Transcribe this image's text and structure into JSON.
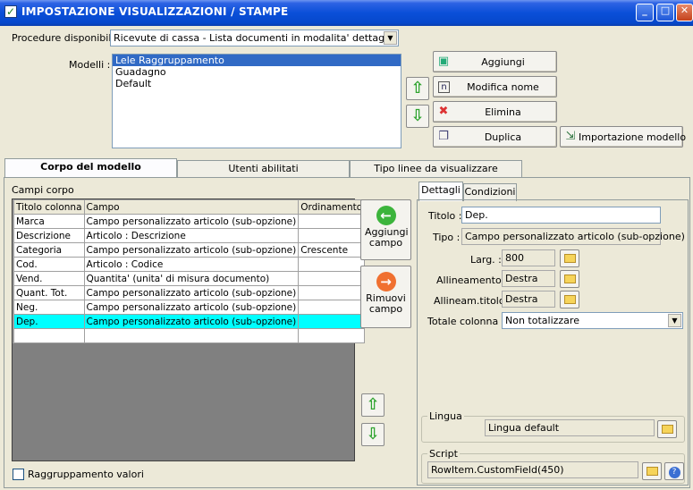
{
  "window": {
    "title": "IMPOSTAZIONE VISUALIZZAZIONI / STAMPE"
  },
  "procedure": {
    "label": "Procedure disponibili :",
    "value": "Ricevute di cassa - Lista documenti in modalita' dettaglio"
  },
  "modelli": {
    "label": "Modelli :",
    "items": [
      "Lele Raggruppamento",
      "Guadagno",
      "Default"
    ],
    "selected_index": 0
  },
  "buttons": {
    "aggiungi": "Aggiungi",
    "modifica_nome": "Modifica nome",
    "elimina": "Elimina",
    "duplica": "Duplica",
    "importazione": "Importazione modello"
  },
  "tabs": [
    "Corpo del modello",
    "Utenti abilitati",
    "Tipo linee da visualizzare"
  ],
  "campi_corpo": {
    "label": "Campi corpo",
    "columns": [
      "Titolo colonna",
      "Campo",
      "Ordinamento"
    ],
    "rows": [
      [
        "Marca",
        "Campo personalizzato articolo (sub-opzione)",
        ""
      ],
      [
        "Descrizione",
        "Articolo : Descrizione",
        ""
      ],
      [
        "Categoria",
        "Campo personalizzato articolo (sub-opzione)",
        "Crescente"
      ],
      [
        "Cod.",
        "Articolo : Codice",
        ""
      ],
      [
        "Vend.",
        "Quantita' (unita' di misura documento)",
        ""
      ],
      [
        "Quant. Tot.",
        "Campo personalizzato articolo (sub-opzione)",
        ""
      ],
      [
        "Neg.",
        "Campo personalizzato articolo (sub-opzione)",
        ""
      ],
      [
        "Dep.",
        "Campo personalizzato articolo (sub-opzione)",
        ""
      ],
      [
        "",
        "",
        ""
      ]
    ],
    "selected_row": 7
  },
  "side_buttons": {
    "aggiungi_campo": "Aggiungi campo",
    "rimuovi_campo": "Rimuovi campo"
  },
  "detail_tabs": [
    "Dettagli",
    "Condizioni"
  ],
  "dettagli": {
    "titolo_label": "Titolo :",
    "titolo": "Dep.",
    "tipo_label": "Tipo :",
    "tipo": "Campo personalizzato articolo (sub-opzione)",
    "larg_label": "Larg. :",
    "larg": "800",
    "allineamento_label": "Allineamento :",
    "allineamento": "Destra",
    "allineam_titolo_label": "Allineam.titolo :",
    "allineam_titolo": "Destra",
    "totale_label": "Totale colonna :",
    "totale": "Non totalizzare"
  },
  "lingua": {
    "label": "Lingua",
    "value": "Lingua default"
  },
  "script": {
    "label": "Script",
    "value": "RowItem.CustomField(450)"
  },
  "raggruppamento": {
    "label": "Raggruppamento valori",
    "checked": false
  }
}
